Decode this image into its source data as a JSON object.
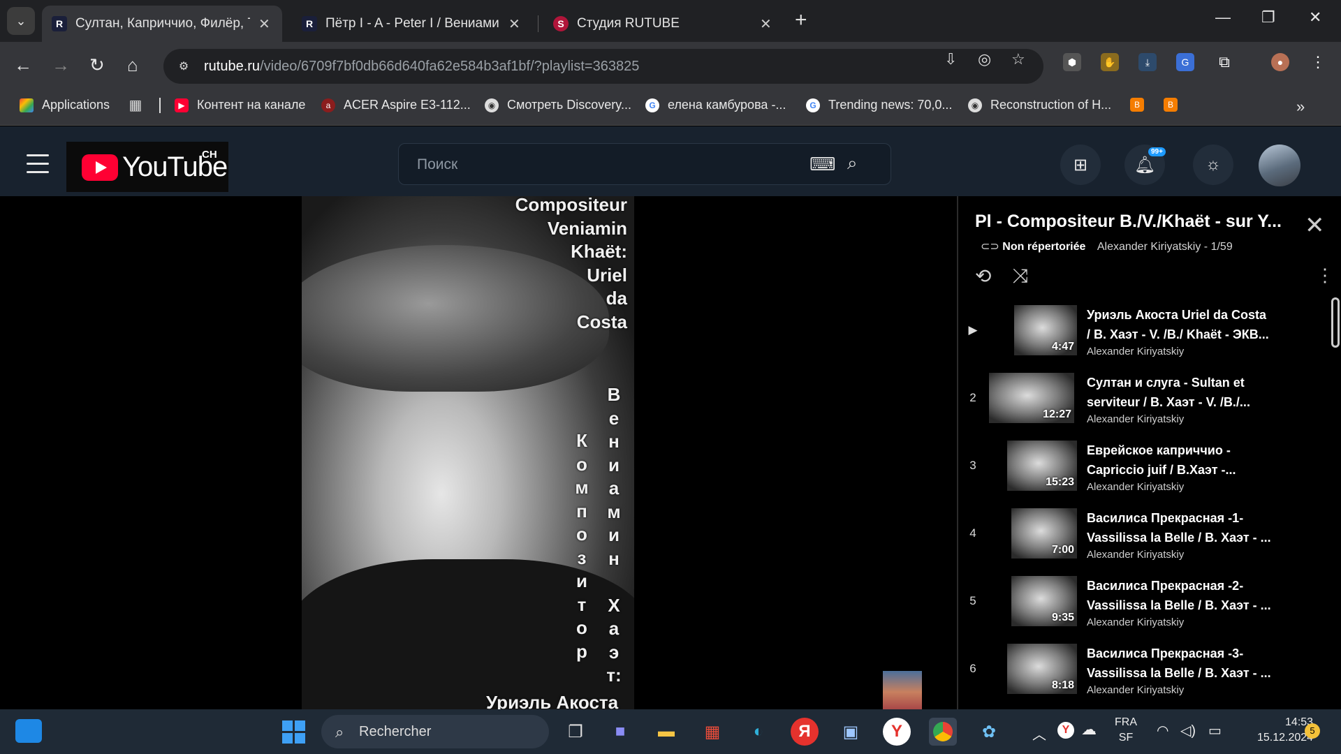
{
  "browser": {
    "tabs": [
      {
        "title": "Султан, Каприччио, Филёр, Та",
        "active": true
      },
      {
        "title": "Пётр I - A - Peter I / Вениамин",
        "active": false
      },
      {
        "title": "Студия RUTUBE",
        "active": false
      }
    ],
    "url_host": "rutube.ru",
    "url_path": "/video/6709f7bf0db66d640fa62e584b3af1bf/?playlist=363825",
    "bookmarks": [
      "Applications",
      "Контент на канале",
      "ACER Aspire E3-112...",
      "Смотреть Discovery...",
      "елена камбурова -...",
      "Trending news: 70,0...",
      "Reconstruction of H..."
    ]
  },
  "site": {
    "logo_text": "YouTube",
    "logo_sup": "CH",
    "search_placeholder": "Поиск",
    "notif_badge": "99+"
  },
  "poster": {
    "title_lines": [
      "Compositeur",
      "Veniamin",
      "Khaët:",
      "Uriel",
      "da",
      "Costa"
    ],
    "col1": [
      "К",
      "о",
      "м",
      "п",
      "о",
      "з",
      "и",
      "т",
      "о",
      "р"
    ],
    "col2": [
      "В",
      "е",
      "н",
      "и",
      "а",
      "м",
      "и",
      "н",
      "",
      "Х",
      "а",
      "э",
      "т:"
    ],
    "bottom": "Уриэль Акоста"
  },
  "playlist": {
    "title": "Pl - Compositeur B./V./Khaët - sur Y...",
    "visibility": "Non répertoriée",
    "owner_position": "Alexander Kiriyatskiy - 1/59",
    "items": [
      {
        "idx": "▶",
        "line1": "Уриэль Акоста Uriel da Costa",
        "line2": "/ В. Хаэт - V. /B./ Khaët - ЭКВ...",
        "channel": "Alexander Kiriyatskiy",
        "duration": "4:47"
      },
      {
        "idx": "2",
        "line1": "Султан и слуга - Sultan et",
        "line2": "serviteur / В. Хаэт - V. /B./...",
        "channel": "Alexander Kiriyatskiy",
        "duration": "12:27"
      },
      {
        "idx": "3",
        "line1": "Еврейское каприччио -",
        "line2": "Capriccio juif / В.Хаэт -...",
        "channel": "Alexander Kiriyatskiy",
        "duration": "15:23"
      },
      {
        "idx": "4",
        "line1": "Василиса Прекрасная -1-",
        "line2": "Vassilissa la Belle / В. Хаэт - ...",
        "channel": "Alexander Kiriyatskiy",
        "duration": "7:00"
      },
      {
        "idx": "5",
        "line1": "Василиса Прекрасная -2-",
        "line2": "Vassilissa la Belle / В. Хаэт - ...",
        "channel": "Alexander Kiriyatskiy",
        "duration": "9:35"
      },
      {
        "idx": "6",
        "line1": "Василиса Прекрасная -3-",
        "line2": "Vassilissa la Belle / В. Хаэт - ...",
        "channel": "Alexander Kiriyatskiy",
        "duration": "8:18"
      }
    ]
  },
  "taskbar": {
    "search_placeholder": "Rechercher",
    "lang": "FRA",
    "layout": "SF",
    "time": "14:53",
    "date": "15.12.2024",
    "notif_count": "5"
  }
}
